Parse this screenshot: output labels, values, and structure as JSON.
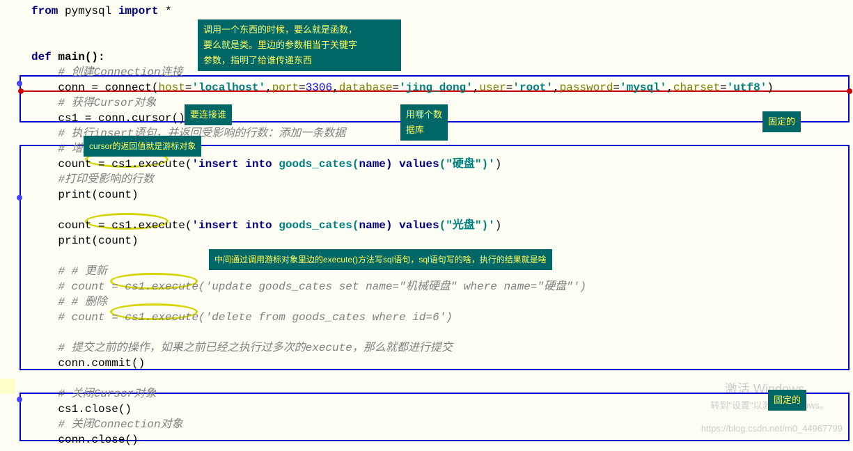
{
  "code": {
    "line1_from": "from",
    "line1_module": " pymysql ",
    "line1_import": "import",
    "line1_star": " *",
    "line_def": "def",
    "line_main": " main():",
    "comment_conn": "# 创建Connection连接",
    "conn_assign": "conn = connect(",
    "host_param": "host",
    "eq": "=",
    "host_val": "'localhost'",
    "comma": ",",
    "port_param": "port",
    "port_val": "3306",
    "db_param": "database",
    "db_val": "'jing_dong'",
    "user_param": "user",
    "user_val": "'root'",
    "pwd_param": "password",
    "pwd_val": "'mysql'",
    "charset_param": "charset",
    "charset_val": "'utf8'",
    "close_paren": ")",
    "comment_cursor": "# 获得Cursor对象",
    "cs1_line": "cs1 = conn.cursor()",
    "comment_insert": "# 执行insert语句，并返回受影响的行数：添加一条数据",
    "comment_add": "# 增加",
    "count1_pre": "count = cs1.execute(",
    "sql1_insert": "'insert into",
    "sql1_rest": " goods_cates(",
    "sql1_name": "name",
    "sql1_values": ") values",
    "sql1_val": "(\"硬盘\")'",
    "comment_print": "#打印受影响的行数",
    "print_count": "print(count)",
    "sql2_val": "(\"光盘\")'",
    "comment_update_h": "# # 更新",
    "comment_update": "# count = cs1.execute('update goods_cates set name=\"机械硬盘\" where name=\"硬盘\"')",
    "comment_delete_h": "# # 删除",
    "comment_delete": "# count = cs1.execute('delete from goods_cates where id=6')",
    "comment_commit": "# 提交之前的操作，如果之前已经之执行过多次的execute，那么就都进行提交",
    "commit_line": "conn.commit()",
    "comment_close_cursor": "# 关闭Cursor对象",
    "cs1_close": "cs1.close()",
    "comment_close_conn": "# 关闭Connection对象",
    "conn_close": "conn.close()"
  },
  "annotations": {
    "top_box": "调用一个东西的时候，要么就是函数，\n要么就是类。里边的参数相当于关键字\n参数，指明了给谁传递东西",
    "connect_who": "要连接谁",
    "which_db": "用哪个数\n据库",
    "fixed1": "固定的",
    "cursor_return": "cursor的返回值就是游标对象",
    "middle_exec": "中间通过调用游标对象里边的execute()方法写sql语句，sql语句写的啥，执行的结果就是啥",
    "fixed2": "固定的"
  },
  "watermark": {
    "activate": "激活 Windows",
    "goto": "转到\"设置\"以激活 Windows。",
    "csdn": "https://blog.csdn.net/m0_44967799"
  }
}
